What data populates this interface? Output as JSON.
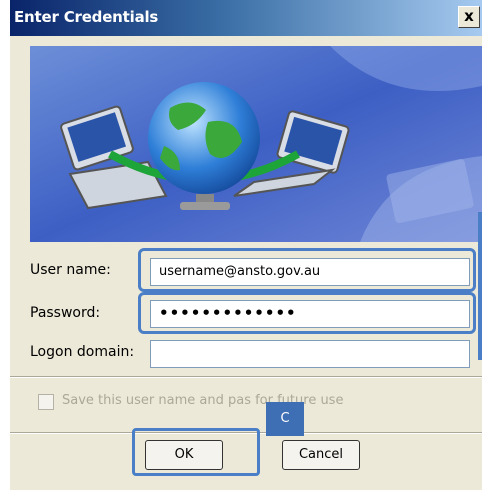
{
  "window": {
    "title": "Enter Credentials",
    "close_glyph": "x"
  },
  "fields": {
    "username": {
      "label": "User name:",
      "value": "username@ansto.gov.au"
    },
    "password": {
      "label": "Password:",
      "value": "•••••••••••••"
    },
    "domain": {
      "label": "Logon domain:",
      "value": ""
    }
  },
  "save_option": {
    "label": "Save this user name and pas           for future use"
  },
  "buttons": {
    "ok": "OK",
    "cancel": "Cancel"
  },
  "annotation": {
    "badge_label": "C"
  },
  "colors": {
    "highlight": "#4a7ec6",
    "badge": "#3e6fb5",
    "title_bar": "#0a246a"
  },
  "banner_icons": [
    "globe-icon",
    "laptop-icon",
    "laptop-icon"
  ]
}
